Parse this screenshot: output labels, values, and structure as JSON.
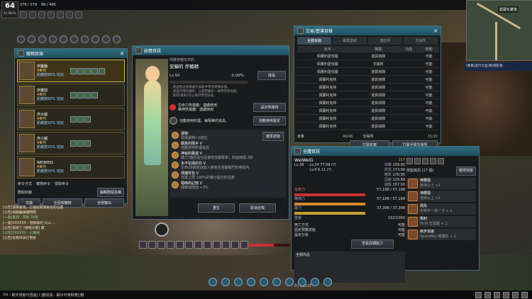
{
  "hud": {
    "level": "64",
    "level_sub": "45.983%",
    "stat1": "279 / 279",
    "stat2": "99 / 405"
  },
  "minimap": {
    "location": "碧蓮化聚落"
  },
  "quest_tracker": {
    "text": "[專業]進行大型[樂]撈釣魚"
  },
  "pet_window": {
    "title": "寵物目錄",
    "pets": [
      {
        "name": "炸醬麵",
        "gen": "4世代",
        "note": "飢餓度80%  追加"
      },
      {
        "name": "炸雞翅",
        "gen": "4世代",
        "note": "飢餓度60%  追加"
      },
      {
        "name": "炸大蝦",
        "gen": "4世代",
        "note": "飢餓度50%  追加"
      },
      {
        "name": "炸小蝦",
        "gen": "4世代",
        "note": "飢餓度55%  追加"
      },
      {
        "name": "WEIWEIG",
        "gen": "4世代",
        "note": "飢餓度55%  追加"
      }
    ],
    "cmd_label": "命令方式",
    "cmd_all": "寵物命令",
    "cmd_follow": "撿取命令",
    "group_label": "群組目錄",
    "group_btn": "編輯群組名稱",
    "btn_swap": "交換",
    "btn_all_recall": "全回收寵物",
    "btn_all_release": "全部寵出"
  },
  "fairy_window": {
    "title": "妖精資訊",
    "subtitle": "閃著夜曦光芒的",
    "name": "安靜的 炸豬精",
    "level": "Lv.50",
    "percent": "0.00%",
    "grow_btn": "成長",
    "desc1": "．透過我這妖精會在技能中學習特殊技能。",
    "desc2": "．透過可用的藥劑，以使用藥水一樣學習新技能。",
    "desc3": "．取得[重製]可以重新學習技能。",
    "auto_potion": "生命力恢復藥：連續使用",
    "auto_potion2": "精神恢復藥：連續使用",
    "auto_set_btn": "設定恢復劑",
    "auto_food": "自動使用料理，每隔等的道具。",
    "auto_food_btn": "自動使用設定",
    "skill_header": "運物",
    "skills": [
      {
        "t": "運物",
        "d": "取道運物+1格位"
      },
      {
        "t": "願意的隨手 V",
        "d": "自動使用料理道具"
      },
      {
        "t": "神秘的擊運 V",
        "d": "體力!連原遠分段會增加暴擊率；所延時間 3秒"
      },
      {
        "t": "永不枯竭的井 V",
        "d": "生命/道網道說進入將會在自動戰門的時間內"
      },
      {
        "t": "便攜背包 V",
        "d": "負重上限 100%的幾分提交的位數"
      },
      {
        "t": "隨時的記憶 V",
        "d": "經驗值增加 +3%"
      }
    ],
    "change_skill": "變更技能",
    "btn_rebirth": "重生",
    "btn_cancel": "取消召喚"
  },
  "trade_window": {
    "title": "交易/營運目錄",
    "tabs": [
      "全體目錄",
      "專業連結",
      "運送中",
      "交易所"
    ],
    "headers": [
      "名字",
      "職業",
      "功能",
      "移動"
    ],
    "rows": [
      [
        "佩爾利愛伐羅",
        "運貨商隊",
        "可能"
      ],
      [
        "佩爾利愛伐羅",
        "交易所",
        "可能"
      ],
      [
        "佩爾利愛伐羅",
        "運貨商隊",
        "可能"
      ],
      [
        "佩爾利克林",
        "運貨商隊",
        "可能"
      ],
      [
        "佩爾利克林",
        "運貨商隊",
        "可能"
      ],
      [
        "佩爾利克林",
        "運貨商隊",
        "可能"
      ],
      [
        "佩爾利克林",
        "運貨商隊",
        "可能"
      ],
      [
        "佩爾利克林",
        "運貨商隊",
        "可能"
      ],
      [
        "佩爾利克林",
        "運貨商隊",
        "可能"
      ],
      [
        "佩爾利克林",
        "運貨商隊",
        "可能"
      ]
    ],
    "label_count": "倉庫",
    "count": "46/46",
    "label_trade": "交易所",
    "trade_count": "15/15",
    "btn_open": "打開倉庫",
    "btn_open_trade": "打開全球交易所"
  },
  "status_window": {
    "title": "全體資訊",
    "char_name": "WeiWeiG",
    "level": "Lv.38",
    "exp1": "Lv.24 77.09 (?)",
    "exp2": "Lv.9 6.11 (?)",
    "hp_label": "生命力",
    "hp": "57,198 / 57,198",
    "stam_label": "精神力",
    "stam": "57,198 / 57,198",
    "energy_label": "能力",
    "energy": "37,398 / 37,398",
    "weight_label": "重量",
    "weight": "102/1000",
    "stats": [
      [
        "攻擊",
        "159.95"
      ],
      [
        "防禦",
        "173.99"
      ],
      [
        "精準",
        "176.95"
      ],
      [
        "迴避",
        "129.89"
      ],
      [
        "減傷",
        "157.00"
      ]
    ],
    "rank": "157",
    "row_labels": [
      "死亡方式",
      "固定預覽技能",
      "設定分析"
    ],
    "row_vals": [
      "可能",
      "可能",
      "可能"
    ],
    "btn_all_ability": "查看詳細能力",
    "inv_label": "全額商品",
    "skill_panel_title": "技能資訊 (17 個)",
    "btn_change": "變更技能",
    "mini_skills": [
      {
        "t": "神鷹隨",
        "d": "使用以上 +1"
      },
      {
        "t": "神鷹隨",
        "d": "使用以上 +1"
      },
      {
        "t": "飛鳥",
        "d": "手臂中一道一卡 + 1"
      },
      {
        "t": "衝刺",
        "d": "Shift 位置鍵 + 1"
      },
      {
        "t": "疾步加速",
        "d": "SpaceBar 格擋的 + 1"
      }
    ],
    "footer": "0 / 285 LT"
  },
  "chat": [
    "[公告]冒險者等。已連結來源角色的位置",
    "[公告]伺服器維護時間",
    "[一般]黑洞 : 求組 30等",
    "[一般]XXXXXX : 冒險家的 天山 ...",
    "[公告]發現了 [聖暗天使] 寶",
    "[公告]XXXXXX : 已購買",
    "[公告]任務目錄已更新"
  ],
  "bottom_bar": {
    "text": "TIP・聊天視窗可透過[↑]鍵追加，顯示可用對應[]鍵"
  }
}
